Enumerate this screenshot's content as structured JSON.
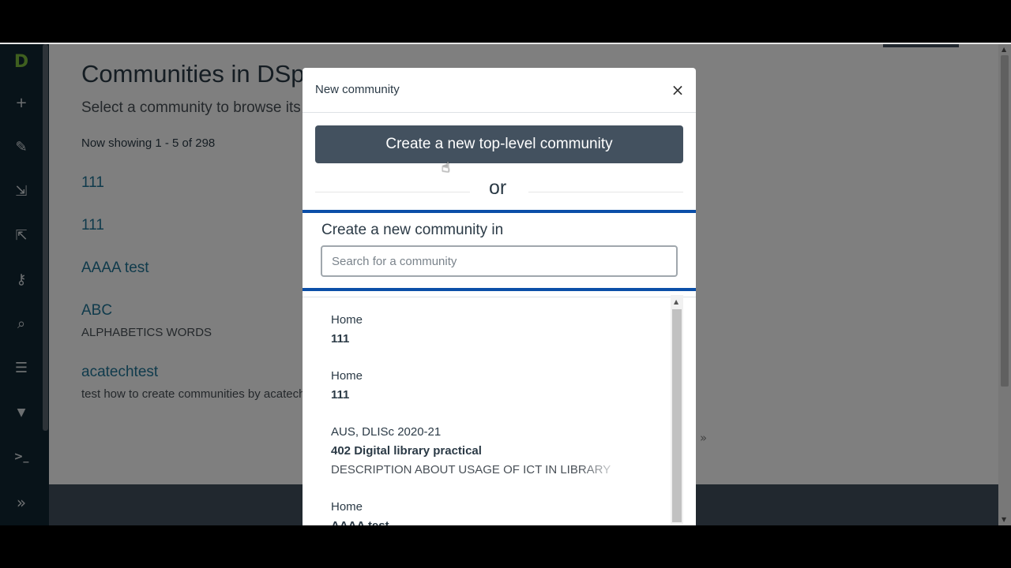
{
  "page": {
    "title": "Communities in DSpace",
    "subtitle": "Select a community to browse its collections.",
    "showing": "Now showing 1 - 5 of 298",
    "communities": [
      {
        "name": "111",
        "description": ""
      },
      {
        "name": "111",
        "description": ""
      },
      {
        "name": "AAAA test",
        "description": ""
      },
      {
        "name": "ABC",
        "description": "ALPHABETICS WORDS"
      },
      {
        "name": "acatechtest",
        "description": "test how to create communities by acatech"
      }
    ],
    "pager_next": "»"
  },
  "sidebar": {
    "logo": "D",
    "icons": [
      "plus-icon",
      "pencil-icon",
      "import-icon",
      "export-icon",
      "key-icon",
      "search-icon",
      "list-icon",
      "filter-icon",
      "terminal-icon",
      "expand-icon"
    ],
    "glyphs": [
      "+",
      "✎",
      "⇲",
      "⇱",
      "⚷",
      "⌕",
      "☰",
      "▼",
      ">_",
      "»"
    ]
  },
  "modal": {
    "title": "New community",
    "close": "×",
    "top_level_button": "Create a new top-level community",
    "or": "or",
    "create_in_label": "Create a new community in",
    "search_placeholder": "Search for a community",
    "results": [
      {
        "parent": "Home",
        "name": "111",
        "description": ""
      },
      {
        "parent": "Home",
        "name": "111",
        "description": ""
      },
      {
        "parent": "AUS, DLISc 2020-21",
        "name": "402 Digital library practical",
        "description": "DESCRIPTION ABOUT USAGE OF ICT IN LIBRARY"
      },
      {
        "parent": "Home",
        "name": "AAAA test",
        "description": ""
      }
    ]
  },
  "colors": {
    "sidebar": "#112733",
    "primary": "#43515f",
    "link": "#207698",
    "highlight": "#0b4fa8"
  }
}
